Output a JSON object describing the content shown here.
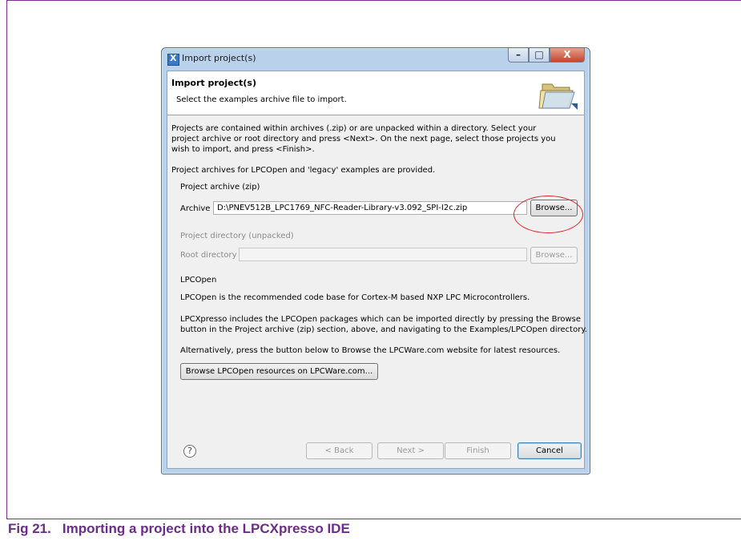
{
  "window": {
    "title": "Import project(s)",
    "controls": {
      "minimize": "–",
      "maximize": "□",
      "close": "X"
    }
  },
  "header": {
    "title": "Import project(s)",
    "subtitle": "Select the examples archive file to import."
  },
  "intro": {
    "line1": "Projects are contained within archives (.zip) or are unpacked within a directory. Select your",
    "line2": "project archive or root directory and press <Next>. On the next page, select those projects you",
    "line3": "wish to import, and press <Finish>.",
    "line4": "Project archives for LPCOpen and 'legacy' examples are provided."
  },
  "archive_section": {
    "title": "Project archive (zip)",
    "label": "Archive",
    "value": "D:\\PNEV512B_LPC1769_NFC-Reader-Library-v3.092_SPI-I2c.zip",
    "browse_label": "Browse..."
  },
  "directory_section": {
    "title": "Project directory (unpacked)",
    "label": "Root directory",
    "value": "",
    "browse_label": "Browse..."
  },
  "lpcopen": {
    "title": "LPCOpen",
    "line1": "LPCOpen is the recommended code base for Cortex-M based NXP LPC Microcontrollers.",
    "line2": "LPCXpresso includes the LPCOpen packages which can be imported directly by pressing the Browse",
    "line3": "button in the Project archive (zip) section, above, and navigating to the Examples/LPCOpen directory.",
    "line4": "Alternatively, press the button below to Browse the LPCWare.com website for latest resources.",
    "button_label": "Browse LPCOpen resources on LPCWare.com..."
  },
  "footer": {
    "help_icon": "?",
    "back_label": "< Back",
    "next_label": "Next >",
    "finish_label": "Finish",
    "cancel_label": "Cancel"
  },
  "caption": {
    "figure": "Fig 21.",
    "text": "Importing a project into the LPCXpresso IDE"
  },
  "colors": {
    "caption": "#6b2c8a",
    "highlight": "#d9262a",
    "window_frame": "#b9d1ea"
  }
}
